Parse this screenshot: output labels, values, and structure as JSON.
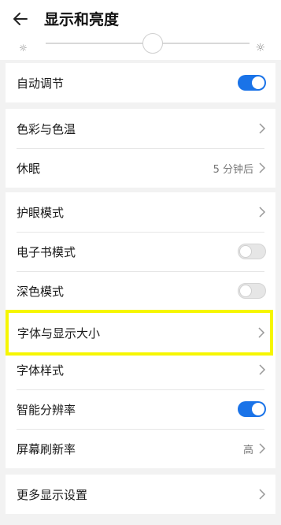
{
  "header": {
    "title": "显示和亮度"
  },
  "auto_adjust": {
    "label": "自动调节",
    "toggle": "on"
  },
  "group2": {
    "color_temp": {
      "label": "色彩与色温"
    },
    "sleep": {
      "label": "休眠",
      "value": "5 分钟后"
    }
  },
  "group3": {
    "eye_care": {
      "label": "护眼模式"
    },
    "ebook": {
      "label": "电子书模式",
      "toggle": "off"
    },
    "dark": {
      "label": "深色模式",
      "toggle": "off"
    },
    "font_size": {
      "label": "字体与显示大小"
    },
    "font_style": {
      "label": "字体样式"
    },
    "smart_res": {
      "label": "智能分辨率",
      "toggle": "on"
    },
    "refresh": {
      "label": "屏幕刷新率",
      "value": "高"
    }
  },
  "group4": {
    "more": {
      "label": "更多显示设置"
    }
  },
  "colors": {
    "accent": "#1a73e8",
    "highlight": "#f6f600"
  }
}
